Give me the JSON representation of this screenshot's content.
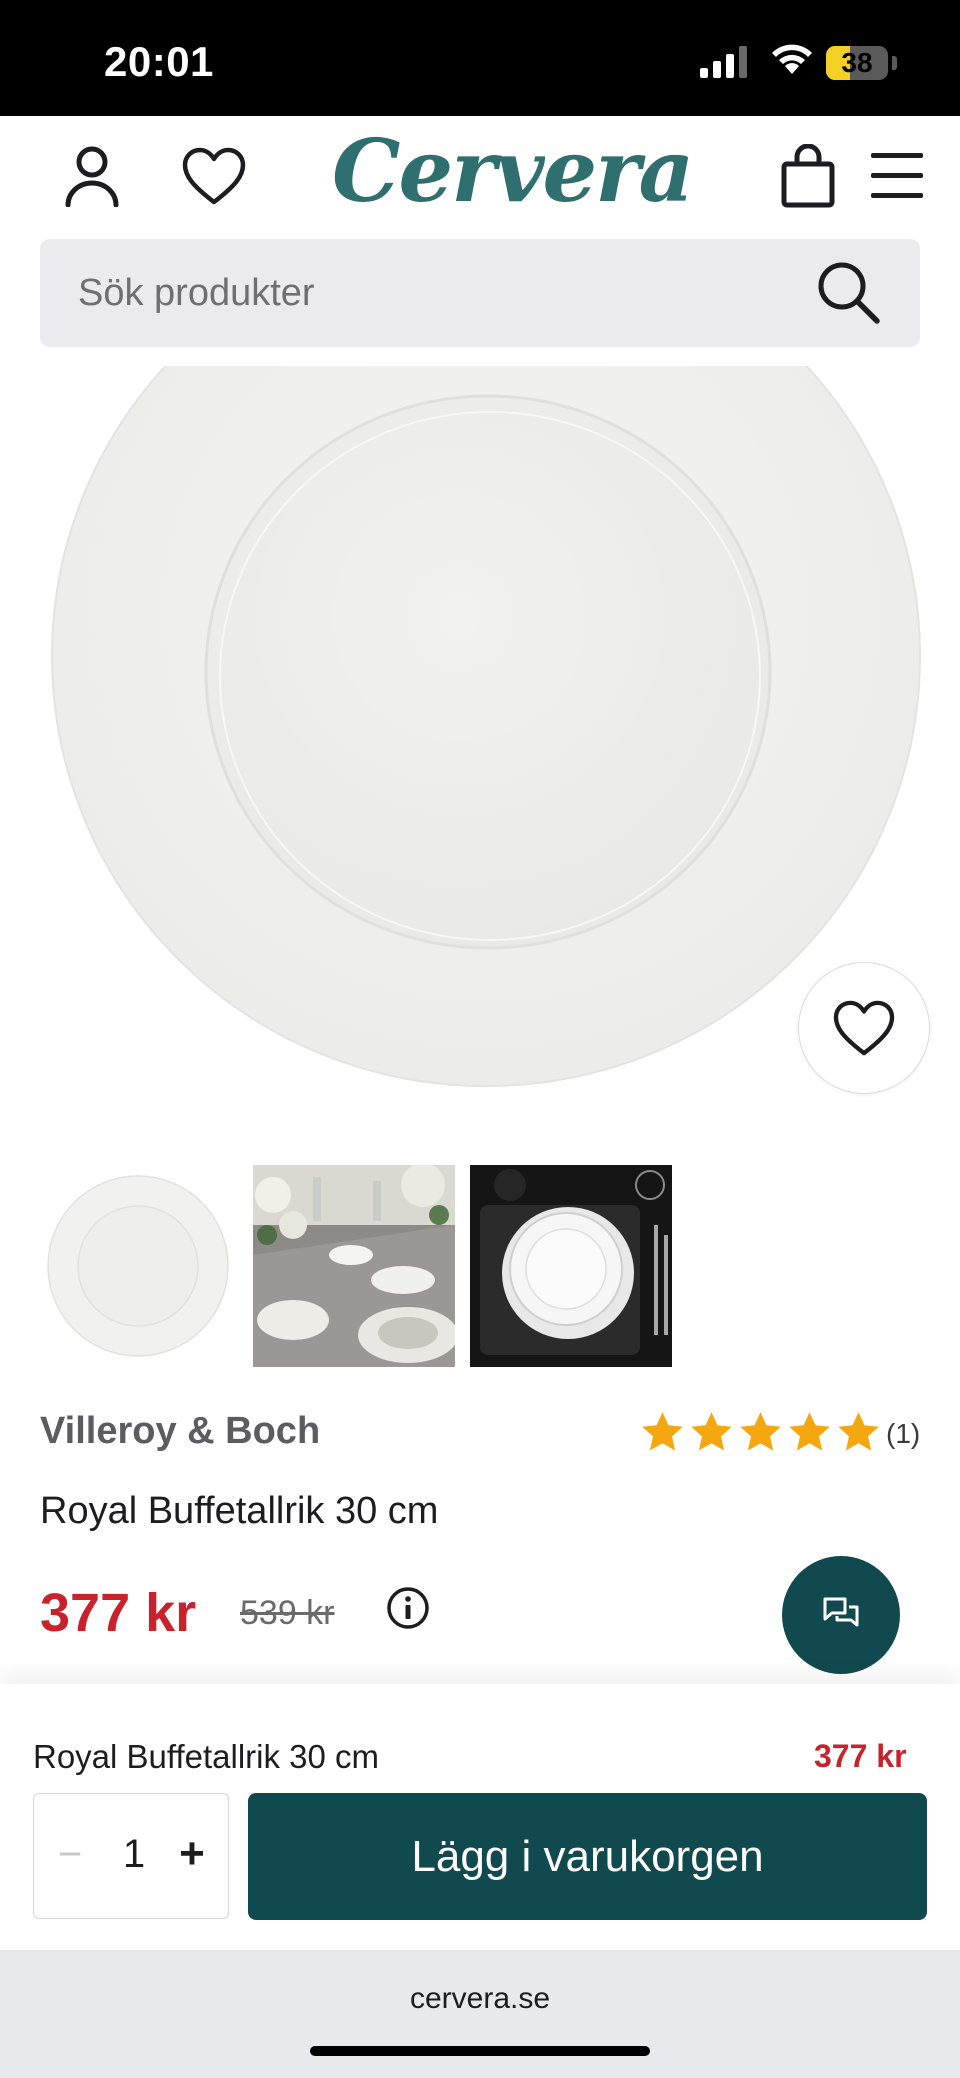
{
  "status_bar": {
    "time": "20:01",
    "battery_level": "38",
    "battery_fraction": 0.38
  },
  "header": {
    "logo_text": "Cervera",
    "icons": [
      "user-icon",
      "heart-icon",
      "bag-icon",
      "menu-icon"
    ]
  },
  "search": {
    "placeholder": "Sök produkter"
  },
  "product": {
    "brand": "Villeroy & Boch",
    "rating": 5,
    "review_count": "(1)",
    "name": "Royal Buffetallrik 30 cm",
    "price": "377 kr",
    "old_price": "539 kr"
  },
  "sticky_bar": {
    "name": "Royal Buffetallrik 30 cm",
    "price": "377 kr",
    "qty_minus": "−",
    "quantity": "1",
    "qty_plus": "+",
    "add_to_cart": "Lägg i varukorgen"
  },
  "browser": {
    "url": "cervera.se"
  },
  "colors": {
    "brand_teal": "#2f6f6f",
    "button_dark": "#114a4e",
    "price_red": "#c8232c",
    "star": "#f5a70f"
  }
}
